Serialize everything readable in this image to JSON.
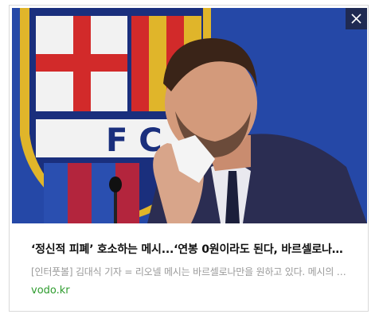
{
  "ad": {
    "image_alt_icon": "news-photo",
    "close_icon": "close-icon",
    "headline": "‘정신적 피폐’ 호소하는 메시...‘연봉 0원이라도 된다, 바르셀로나에 남고 싶다’",
    "snippet": "[인터풋볼] 김대식 기자 = 리오넬 메시는 바르셀로나만을 원하고 있다.  메시의 에이전트는",
    "source": "vodo.kr",
    "colors": {
      "close_bg": "#1f2a52",
      "source_text": "#2e9c2e",
      "snippet_text": "#9a9a9a"
    }
  }
}
